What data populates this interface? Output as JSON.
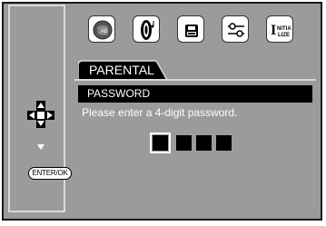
{
  "left_panel": {
    "enter_label": "ENTER/OK"
  },
  "menu": {
    "icons": [
      "language-icon",
      "audio-icon",
      "lock-icon",
      "settings-icon",
      "initialize-icon"
    ],
    "initialize_text": [
      "NITIA",
      "LIZE"
    ],
    "initialize_letter": "I"
  },
  "tab": {
    "label": "PARENTAL"
  },
  "password": {
    "header": "PASSWORD",
    "message": "Please enter a 4-digit password.",
    "digits_total": 4,
    "active_index": 0
  }
}
